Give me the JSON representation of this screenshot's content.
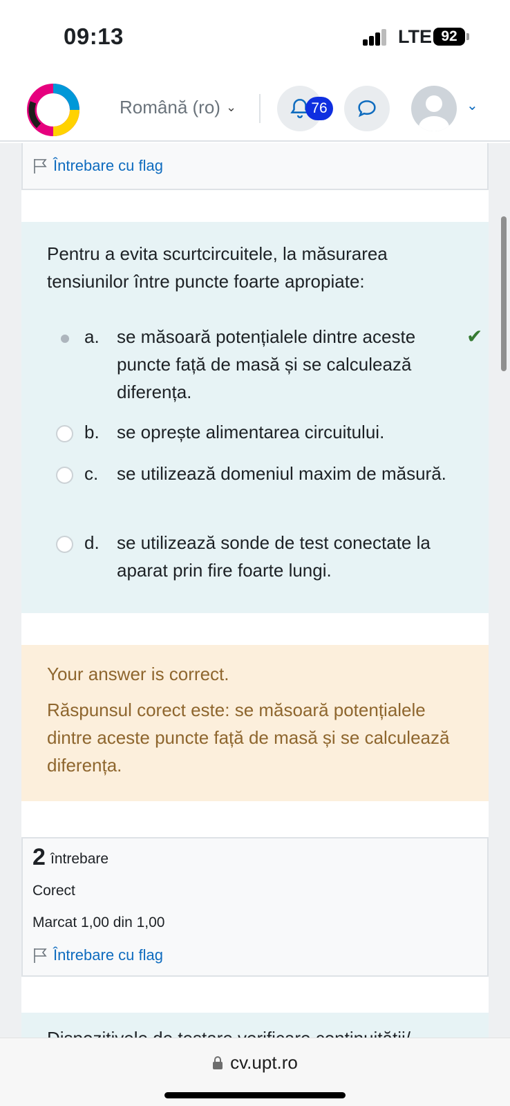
{
  "status_bar": {
    "time": "09:13",
    "network": "LTE",
    "battery": "92"
  },
  "navbar": {
    "language": "Română (ro)",
    "notification_count": "76"
  },
  "flag_top": {
    "label": "Întrebare cu flag"
  },
  "question": {
    "text": "Pentru a evita scurtcircuitele, la măsurarea tensiunilor între puncte foarte apropiate:",
    "options": [
      {
        "letter": "a.",
        "text": "se măsoară potențialele dintre aceste puncte față de masă și se calculează diferența.",
        "selected": true,
        "correct": true
      },
      {
        "letter": "b.",
        "text": "se oprește alimentarea circuitului.",
        "selected": false
      },
      {
        "letter": "c.",
        "text": "se utilizează domeniul maxim de măsură.",
        "selected": false
      },
      {
        "letter": "d.",
        "text": "se utilizează sonde de test conectate la aparat prin fire foarte lungi.",
        "selected": false
      }
    ]
  },
  "feedback": {
    "status": "Your answer is correct.",
    "correct_answer": "Răspunsul corect este: se măsoară potențialele dintre aceste puncte față de masă și se calculează diferența."
  },
  "question_info": {
    "number": "2",
    "word": "întrebare",
    "state": "Corect",
    "mark": "Marcat 1,00 din 1,00",
    "flag_label": "Întrebare cu flag"
  },
  "next_question": {
    "text_partial": "Dispozitivele de testare verificare continuității/"
  },
  "url_bar": {
    "domain": "cv.upt.ro"
  },
  "colors": {
    "accent": "#0f6cbf",
    "correct_green": "#357a32",
    "feedback_bg": "#fcefdc",
    "question_bg": "#e7f3f5"
  }
}
